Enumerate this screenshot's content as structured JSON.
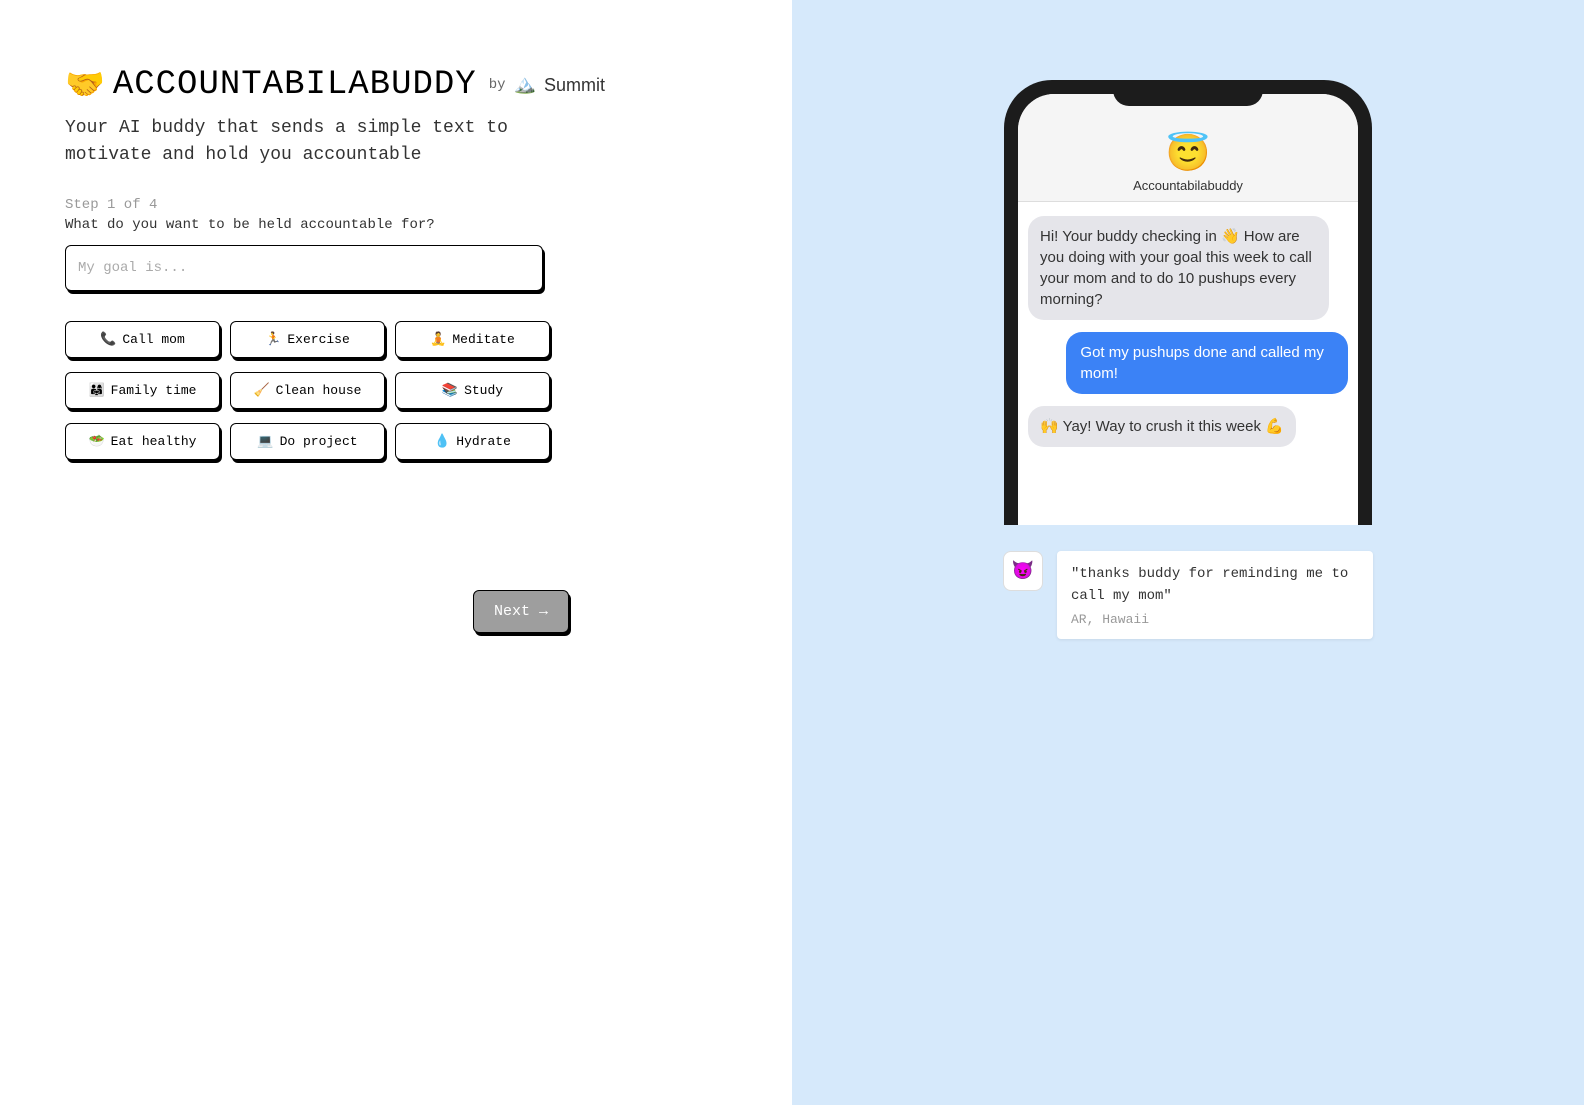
{
  "header": {
    "logo_emoji": "🤝",
    "logo_text": "ACCOUNTABILABUDDY",
    "by_label": "by",
    "summit_icon": "🏔️",
    "summit_text": "Summit"
  },
  "tagline": "Your AI buddy that sends a simple text to motivate and hold you accountable",
  "form": {
    "step_label": "Step 1 of 4",
    "question": "What do you want to be held accountable for?",
    "placeholder": "My goal is...",
    "value": ""
  },
  "chips": [
    {
      "emoji": "📞",
      "label": "Call mom"
    },
    {
      "emoji": "🏃",
      "label": "Exercise"
    },
    {
      "emoji": "🧘",
      "label": "Meditate"
    },
    {
      "emoji": "👨‍👩‍👧",
      "label": "Family time"
    },
    {
      "emoji": "🧹",
      "label": "Clean house"
    },
    {
      "emoji": "📚",
      "label": "Study"
    },
    {
      "emoji": "🥗",
      "label": "Eat healthy"
    },
    {
      "emoji": "💻",
      "label": "Do project"
    },
    {
      "emoji": "💧",
      "label": "Hydrate"
    }
  ],
  "next_button": "Next →",
  "phone": {
    "angel": "😇",
    "name": "Accountabilabuddy",
    "msg1": "Hi! Your buddy checking in 👋 How are you doing with your goal this week to call your mom and to do 10 pushups every morning?",
    "msg2": "Got my pushups done and called my mom!",
    "msg3": "🙌 Yay!  Way to crush it this week 💪"
  },
  "testimonial": {
    "avatar": "😈",
    "quote": "\"thanks buddy for reminding me to call my mom\"",
    "author": "AR, Hawaii"
  }
}
